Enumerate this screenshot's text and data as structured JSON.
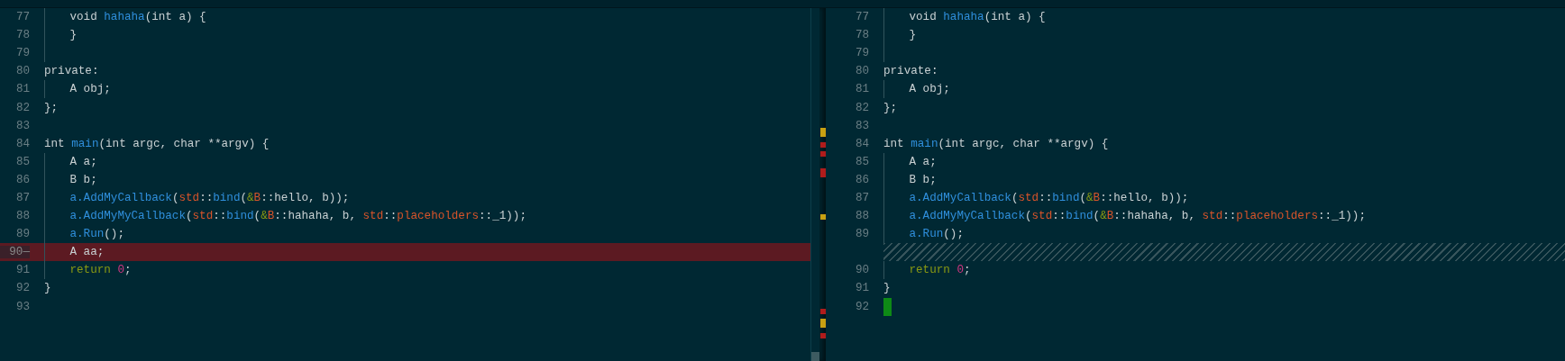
{
  "left_pane": {
    "lines": [
      {
        "number": "77",
        "kind": "normal",
        "indented": true,
        "tokens": [
          {
            "kind": "plain",
            "text": "void "
          },
          {
            "kind": "fn",
            "text": "hahaha"
          },
          {
            "kind": "plain",
            "text": "(int a) {"
          }
        ]
      },
      {
        "number": "78",
        "kind": "normal",
        "indented": true,
        "tokens": [
          {
            "kind": "plain",
            "text": "}"
          }
        ]
      },
      {
        "number": "79",
        "kind": "normal",
        "indented": true
      },
      {
        "number": "80",
        "kind": "normal",
        "indented": false,
        "tokens": [
          {
            "kind": "plain",
            "text": "private:"
          }
        ]
      },
      {
        "number": "81",
        "kind": "normal",
        "indented": true,
        "tokens": [
          {
            "kind": "plain",
            "text": "A obj;"
          }
        ]
      },
      {
        "number": "82",
        "kind": "normal",
        "indented": false,
        "tokens": [
          {
            "kind": "plain",
            "text": "};"
          }
        ]
      },
      {
        "number": "83",
        "kind": "normal",
        "indented": false
      },
      {
        "number": "84",
        "kind": "normal",
        "indented": false,
        "tokens": [
          {
            "kind": "plain",
            "text": "int "
          },
          {
            "kind": "fn",
            "text": "main"
          },
          {
            "kind": "plain",
            "text": "(int argc, char **argv) {"
          }
        ]
      },
      {
        "number": "85",
        "kind": "normal",
        "indented": true,
        "tokens": [
          {
            "kind": "plain",
            "text": "A a;"
          }
        ]
      },
      {
        "number": "86",
        "kind": "normal",
        "indented": true,
        "tokens": [
          {
            "kind": "plain",
            "text": "B b;"
          }
        ]
      },
      {
        "number": "87",
        "kind": "normal",
        "indented": true,
        "tokens": [
          {
            "kind": "fn",
            "text": "a.AddMyCallback"
          },
          {
            "kind": "plain",
            "text": "("
          },
          {
            "kind": "ns",
            "text": "std"
          },
          {
            "kind": "plain",
            "text": "::"
          },
          {
            "kind": "fn",
            "text": "bind"
          },
          {
            "kind": "plain",
            "text": "("
          },
          {
            "kind": "amp",
            "text": "&"
          },
          {
            "kind": "ns",
            "text": "B"
          },
          {
            "kind": "plain",
            "text": "::hello, b));"
          }
        ]
      },
      {
        "number": "88",
        "kind": "normal",
        "indented": true,
        "tokens": [
          {
            "kind": "fn",
            "text": "a.AddMyMyCallback"
          },
          {
            "kind": "plain",
            "text": "("
          },
          {
            "kind": "ns",
            "text": "std"
          },
          {
            "kind": "plain",
            "text": "::"
          },
          {
            "kind": "fn",
            "text": "bind"
          },
          {
            "kind": "plain",
            "text": "("
          },
          {
            "kind": "amp",
            "text": "&"
          },
          {
            "kind": "ns",
            "text": "B"
          },
          {
            "kind": "plain",
            "text": "::hahaha, b, "
          },
          {
            "kind": "ns",
            "text": "std"
          },
          {
            "kind": "plain",
            "text": "::"
          },
          {
            "kind": "ns",
            "text": "placeholders"
          },
          {
            "kind": "plain",
            "text": "::_1));"
          }
        ]
      },
      {
        "number": "89",
        "kind": "normal",
        "indented": true,
        "tokens": [
          {
            "kind": "fn",
            "text": "a.Run"
          },
          {
            "kind": "plain",
            "text": "();"
          }
        ]
      },
      {
        "number": "90",
        "marker": "—",
        "kind": "removed",
        "indented": true,
        "tokens": [
          {
            "kind": "plain",
            "text": "A aa;"
          }
        ]
      },
      {
        "number": "91",
        "kind": "normal",
        "indented": true,
        "tokens": [
          {
            "kind": "kw",
            "text": "return "
          },
          {
            "kind": "num",
            "text": "0"
          },
          {
            "kind": "plain",
            "text": ";"
          }
        ]
      },
      {
        "number": "92",
        "kind": "normal",
        "indented": false,
        "tokens": [
          {
            "kind": "plain",
            "text": "}"
          }
        ]
      },
      {
        "number": "93",
        "kind": "normal",
        "indented": false
      }
    ]
  },
  "right_pane": {
    "lines": [
      {
        "number": "77",
        "kind": "normal",
        "indented": true,
        "tokens": [
          {
            "kind": "plain",
            "text": "void "
          },
          {
            "kind": "fn",
            "text": "hahaha"
          },
          {
            "kind": "plain",
            "text": "(int a) {"
          }
        ]
      },
      {
        "number": "78",
        "kind": "normal",
        "indented": true,
        "tokens": [
          {
            "kind": "plain",
            "text": "}"
          }
        ]
      },
      {
        "number": "79",
        "kind": "normal",
        "indented": true
      },
      {
        "number": "80",
        "kind": "normal",
        "indented": false,
        "tokens": [
          {
            "kind": "plain",
            "text": "private:"
          }
        ]
      },
      {
        "number": "81",
        "kind": "normal",
        "indented": true,
        "tokens": [
          {
            "kind": "plain",
            "text": "A obj;"
          }
        ]
      },
      {
        "number": "82",
        "kind": "normal",
        "indented": false,
        "tokens": [
          {
            "kind": "plain",
            "text": "};"
          }
        ]
      },
      {
        "number": "83",
        "kind": "normal",
        "indented": false
      },
      {
        "number": "84",
        "kind": "normal",
        "indented": false,
        "tokens": [
          {
            "kind": "plain",
            "text": "int "
          },
          {
            "kind": "fn",
            "text": "main"
          },
          {
            "kind": "plain",
            "text": "(int argc, char **argv) {"
          }
        ]
      },
      {
        "number": "85",
        "kind": "normal",
        "indented": true,
        "tokens": [
          {
            "kind": "plain",
            "text": "A a;"
          }
        ]
      },
      {
        "number": "86",
        "kind": "normal",
        "indented": true,
        "tokens": [
          {
            "kind": "plain",
            "text": "B b;"
          }
        ]
      },
      {
        "number": "87",
        "kind": "normal",
        "indented": true,
        "tokens": [
          {
            "kind": "fn",
            "text": "a.AddMyCallback"
          },
          {
            "kind": "plain",
            "text": "("
          },
          {
            "kind": "ns",
            "text": "std"
          },
          {
            "kind": "plain",
            "text": "::"
          },
          {
            "kind": "fn",
            "text": "bind"
          },
          {
            "kind": "plain",
            "text": "("
          },
          {
            "kind": "amp",
            "text": "&"
          },
          {
            "kind": "ns",
            "text": "B"
          },
          {
            "kind": "plain",
            "text": "::hello, b));"
          }
        ]
      },
      {
        "number": "88",
        "kind": "normal",
        "indented": true,
        "tokens": [
          {
            "kind": "fn",
            "text": "a.AddMyMyCallback"
          },
          {
            "kind": "plain",
            "text": "("
          },
          {
            "kind": "ns",
            "text": "std"
          },
          {
            "kind": "plain",
            "text": "::"
          },
          {
            "kind": "fn",
            "text": "bind"
          },
          {
            "kind": "plain",
            "text": "("
          },
          {
            "kind": "amp",
            "text": "&"
          },
          {
            "kind": "ns",
            "text": "B"
          },
          {
            "kind": "plain",
            "text": "::hahaha, b, "
          },
          {
            "kind": "ns",
            "text": "std"
          },
          {
            "kind": "plain",
            "text": "::"
          },
          {
            "kind": "ns",
            "text": "placeholders"
          },
          {
            "kind": "plain",
            "text": "::_1));"
          }
        ]
      },
      {
        "number": "89",
        "kind": "normal",
        "indented": true,
        "tokens": [
          {
            "kind": "fn",
            "text": "a.Run"
          },
          {
            "kind": "plain",
            "text": "();"
          }
        ]
      },
      {
        "kind": "filler"
      },
      {
        "number": "90",
        "kind": "normal",
        "indented": true,
        "tokens": [
          {
            "kind": "kw",
            "text": "return "
          },
          {
            "kind": "num",
            "text": "0"
          },
          {
            "kind": "plain",
            "text": ";"
          }
        ]
      },
      {
        "number": "91",
        "kind": "normal",
        "indented": false,
        "tokens": [
          {
            "kind": "plain",
            "text": "}"
          }
        ]
      },
      {
        "number": "92",
        "kind": "normal",
        "indented": false,
        "cursor": true
      }
    ]
  }
}
